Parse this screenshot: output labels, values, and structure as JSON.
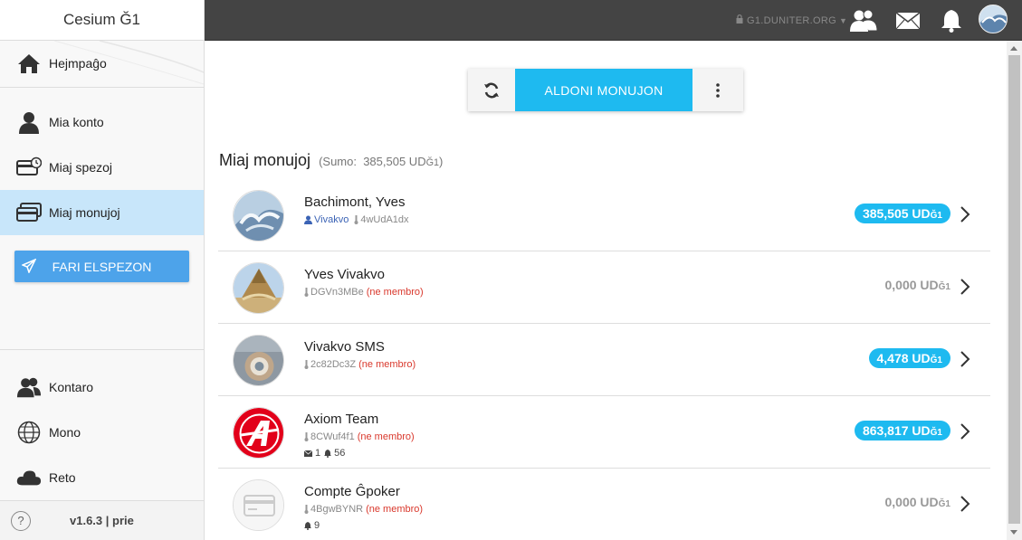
{
  "app": {
    "title": "Cesium Ğ1",
    "version": "v1.6.3 | prie"
  },
  "sidebar": {
    "home": "Hejmpaĝo",
    "account": "Mia konto",
    "expenses": "Miaj spezoj",
    "wallets": "Miaj monujoj",
    "send_button": "FARI ELSPEZON",
    "contacts": "Kontaro",
    "world": "Mono",
    "network": "Reto",
    "help": "?"
  },
  "topbar": {
    "node": "G1.DUNITER.ORG"
  },
  "toolbar": {
    "add_wallet": "ALDONI MONUJON"
  },
  "section": {
    "title": "Miaj monujoj",
    "sum_label": "(Sumo:",
    "sum_value": "385,505 UD",
    "sum_unit": "Ğ1",
    "sum_close": ")"
  },
  "wallets": [
    {
      "name": "Bachimont, Yves",
      "uid": "Vivakvo",
      "pubkey": "4wUdA1dx",
      "non_member": "",
      "balance": "385,505 UD",
      "unit": "Ğ1",
      "extra_msgs": "",
      "extra_notifs": ""
    },
    {
      "name": "Yves Vivakvo",
      "uid": "",
      "pubkey": "DGVn3MBe",
      "non_member": "(ne membro)",
      "balance": "0,000 UD",
      "unit": "Ğ1",
      "extra_msgs": "",
      "extra_notifs": ""
    },
    {
      "name": "Vivakvo SMS",
      "uid": "",
      "pubkey": "2c82Dc3Z",
      "non_member": "(ne membro)",
      "balance": "4,478 UD",
      "unit": "Ğ1",
      "extra_msgs": "",
      "extra_notifs": ""
    },
    {
      "name": "Axiom Team",
      "uid": "",
      "pubkey": "8CWuf4f1",
      "non_member": "(ne membro)",
      "balance": "863,817 UD",
      "unit": "Ğ1",
      "extra_msgs": "1",
      "extra_notifs": "56"
    },
    {
      "name": "Compte Ĝpoker",
      "uid": "",
      "pubkey": "4BgwBYNR",
      "non_member": "(ne membro)",
      "balance": "0,000 UD",
      "unit": "Ğ1",
      "extra_msgs": "",
      "extra_notifs": "9"
    }
  ],
  "colors": {
    "accent": "#1ebaf0",
    "topbar": "#444444",
    "active_item": "#c8e6fa",
    "send_button": "#4da3ea",
    "non_member": "#d9382c"
  }
}
